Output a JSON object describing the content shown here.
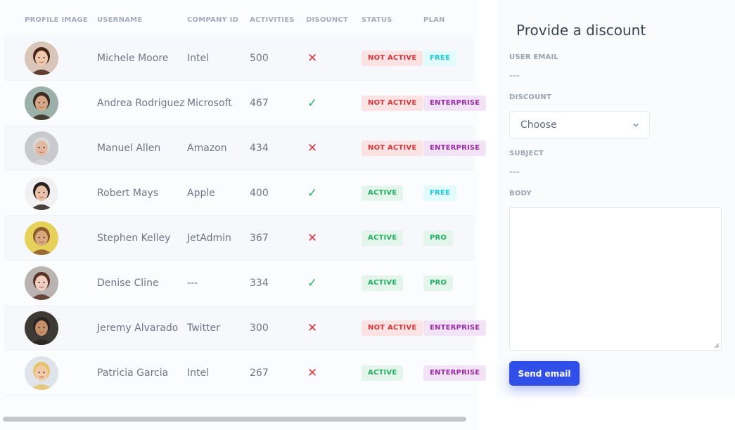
{
  "table": {
    "headers": {
      "profile_image": "PROFILE IMAGE",
      "username": "USERNAME",
      "company_id": "COMPANY ID",
      "activities": "ACTIVITIES",
      "discount": "DISOUNCT",
      "status": "STATUS",
      "plan": "PLAN"
    },
    "rows": [
      {
        "username": "Michele Moore",
        "company": "Intel",
        "activities": "500",
        "discount": "✕",
        "status": "NOT ACTIVE",
        "plan": "FREE"
      },
      {
        "username": "Andrea Rodriguez",
        "company": "Microsoft",
        "activities": "467",
        "discount": "✓",
        "status": "NOT ACTIVE",
        "plan": "ENTERPRISE"
      },
      {
        "username": "Manuel Allen",
        "company": "Amazon",
        "activities": "434",
        "discount": "✕",
        "status": "NOT ACTIVE",
        "plan": "ENTERPRISE"
      },
      {
        "username": "Robert Mays",
        "company": "Apple",
        "activities": "400",
        "discount": "✓",
        "status": "ACTIVE",
        "plan": "FREE"
      },
      {
        "username": "Stephen Kelley",
        "company": "JetAdmin",
        "activities": "367",
        "discount": "✕",
        "status": "ACTIVE",
        "plan": "PRO"
      },
      {
        "username": "Denise Cline",
        "company": "---",
        "activities": "334",
        "discount": "✓",
        "status": "ACTIVE",
        "plan": "PRO"
      },
      {
        "username": "Jeremy Alvarado",
        "company": "Twitter",
        "activities": "300",
        "discount": "✕",
        "status": "NOT ACTIVE",
        "plan": "ENTERPRISE"
      },
      {
        "username": "Patricia Garcia",
        "company": "Intel",
        "activities": "267",
        "discount": "✕",
        "status": "ACTIVE",
        "plan": "ENTERPRISE"
      }
    ]
  },
  "form": {
    "title": "Provide a discount",
    "user_email_label": "USER EMAIL",
    "user_email_value": "---",
    "discount_label": "DISCOUNT",
    "discount_value": "Choose",
    "subject_label": "SUBJECT",
    "subject_value": "---",
    "body_label": "BODY",
    "send_label": "Send email"
  },
  "colors": {
    "accent": "#2f4fe8",
    "danger": "#e03a3e",
    "success": "#27b466"
  },
  "icons": {
    "discount_no": "close-icon",
    "discount_yes": "check-icon",
    "select": "chevron-down-icon"
  }
}
